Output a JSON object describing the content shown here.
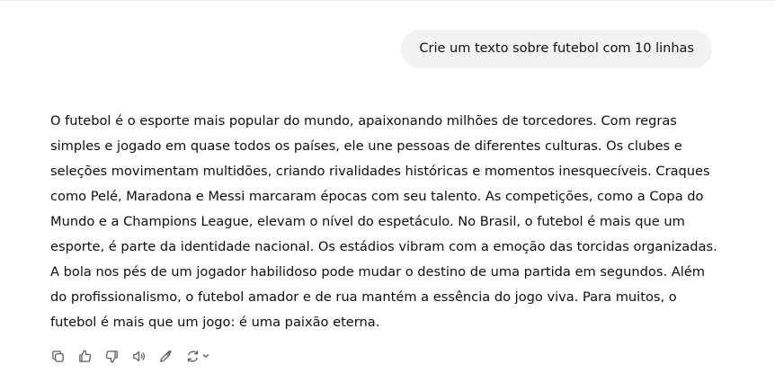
{
  "user_message": {
    "text": "Crie um texto sobre futebol com 10 linhas"
  },
  "assistant_message": {
    "text": "O futebol é o esporte mais popular do mundo, apaixonando milhões de torcedores. Com regras simples e jogado em quase todos os países, ele une pessoas de diferentes culturas. Os clubes e seleções movimentam multidões, criando rivalidades históricas e momentos inesquecíveis. Craques como Pelé, Maradona e Messi marcaram épocas com seu talento. As competições, como a Copa do Mundo e a Champions League, elevam o nível do espetáculo. No Brasil, o futebol é mais que um esporte, é parte da identidade nacional. Os estádios vibram com a emoção das torcidas organizadas. A bola nos pés de um jogador habilidoso pode mudar o destino de uma partida em segundos. Além do profissionalismo, o futebol amador e de rua mantém a essência do jogo viva. Para muitos, o futebol é mais que um jogo: é uma paixão eterna."
  },
  "actions": [
    {
      "icon": "copy-icon"
    },
    {
      "icon": "thumbs-up-icon"
    },
    {
      "icon": "thumbs-down-icon"
    },
    {
      "icon": "read-aloud-icon"
    },
    {
      "icon": "edit-canvas-icon"
    },
    {
      "icon": "regenerate-icon"
    }
  ],
  "colors": {
    "user_bubble_bg": "#f3f3f3",
    "text": "#0d0d0d",
    "icon": "#5d5d5d"
  }
}
